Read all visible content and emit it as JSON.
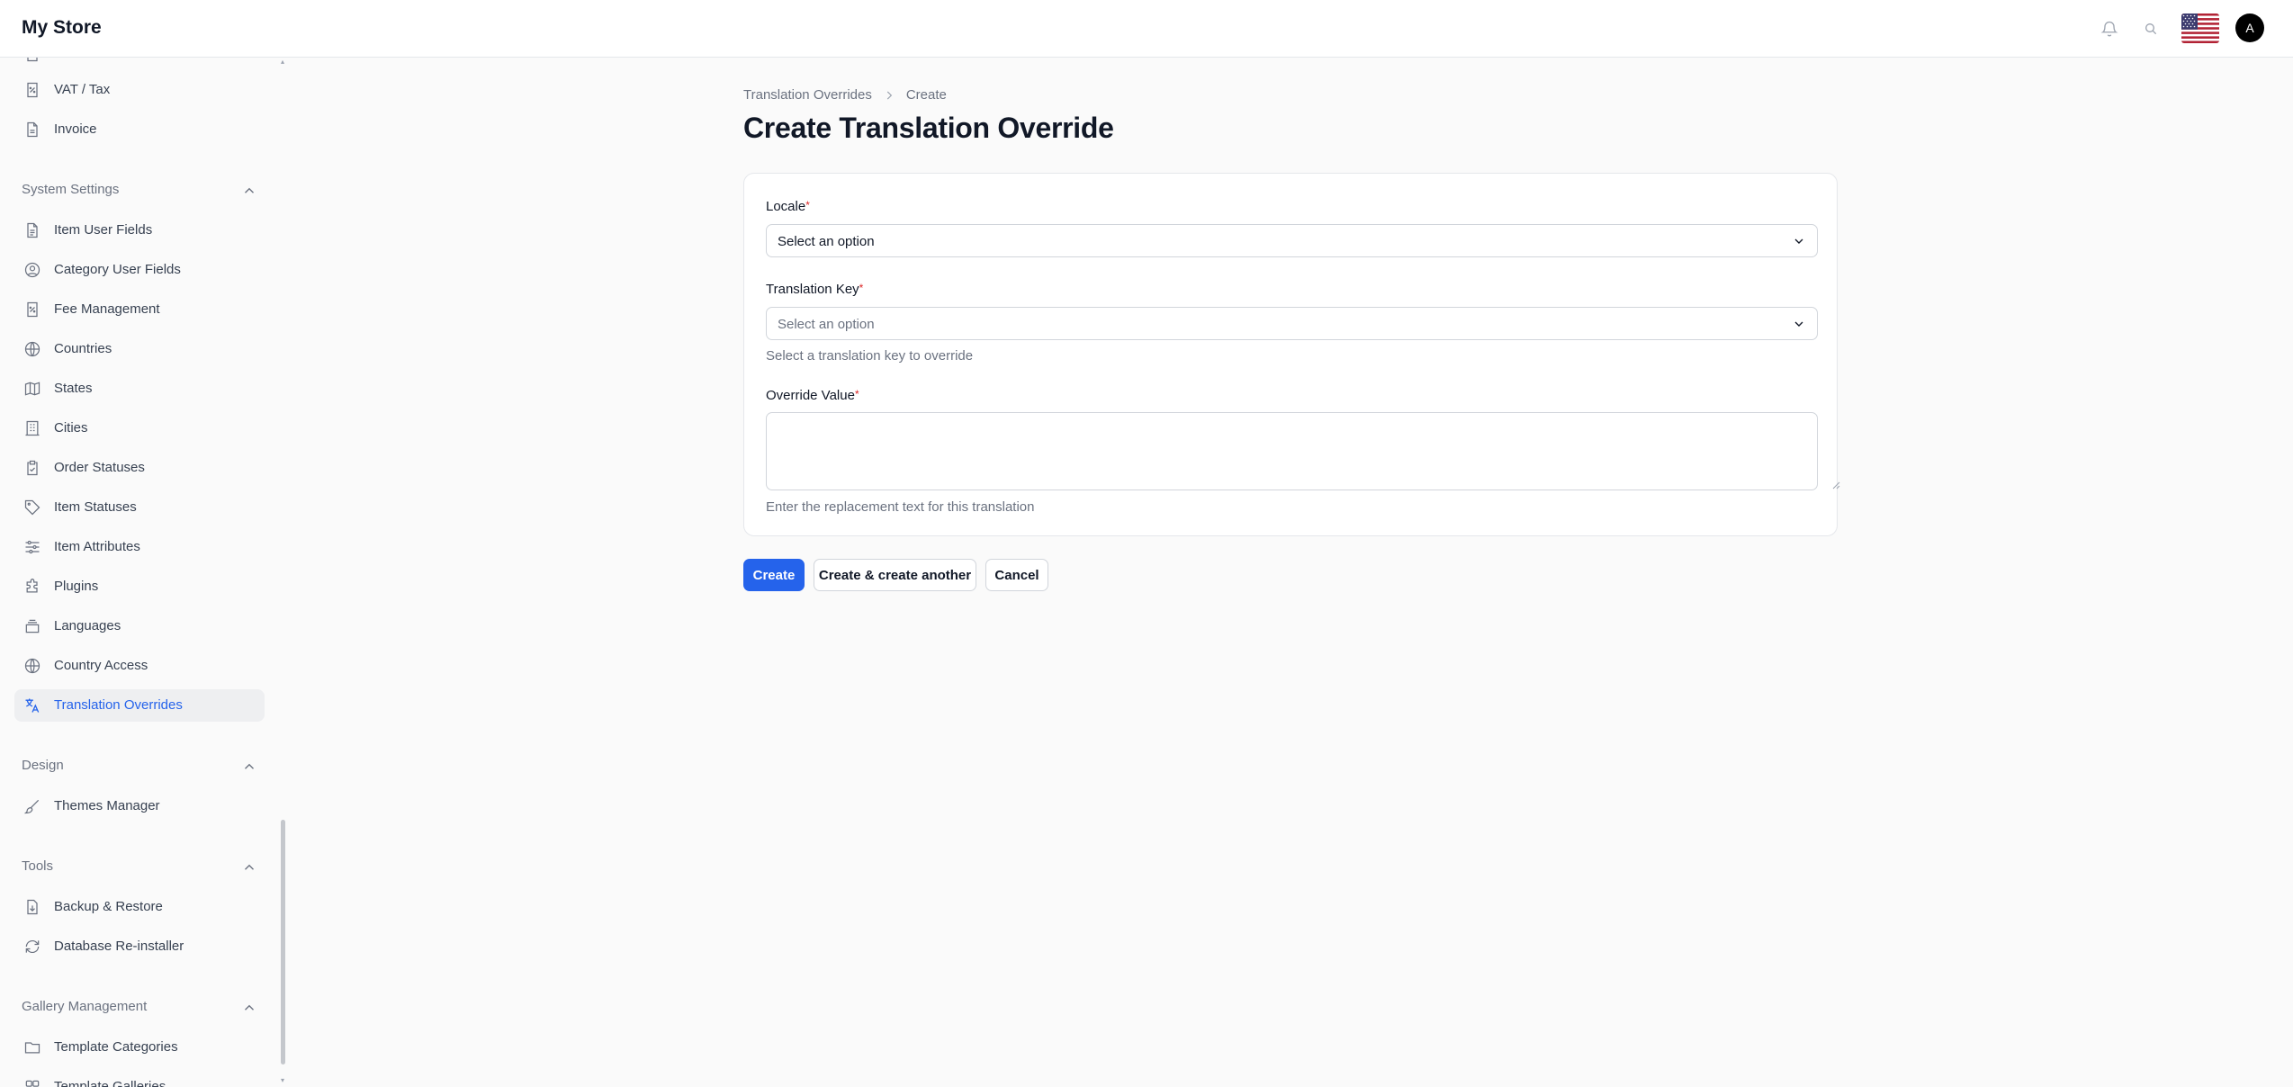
{
  "app": {
    "title": "My Store",
    "avatar_initial": "A"
  },
  "sidebar": {
    "items_top": [
      {
        "label": "VAT / Tax",
        "icon": "receipt-percent-icon"
      },
      {
        "label": "Invoice",
        "icon": "document-icon"
      }
    ],
    "sections": [
      {
        "title": "System Settings",
        "items": [
          {
            "label": "Item User Fields",
            "icon": "document-text-icon"
          },
          {
            "label": "Category User Fields",
            "icon": "user-circle-icon"
          },
          {
            "label": "Fee Management",
            "icon": "receipt-percent-icon"
          },
          {
            "label": "Countries",
            "icon": "globe-icon"
          },
          {
            "label": "States",
            "icon": "map-icon"
          },
          {
            "label": "Cities",
            "icon": "building-icon"
          },
          {
            "label": "Order Statuses",
            "icon": "clipboard-check-icon"
          },
          {
            "label": "Item Statuses",
            "icon": "tag-icon"
          },
          {
            "label": "Item Attributes",
            "icon": "sliders-icon"
          },
          {
            "label": "Plugins",
            "icon": "puzzle-icon"
          },
          {
            "label": "Languages",
            "icon": "stack-icon"
          },
          {
            "label": "Country Access",
            "icon": "globe-icon"
          },
          {
            "label": "Translation Overrides",
            "icon": "language-icon",
            "active": true
          }
        ]
      },
      {
        "title": "Design",
        "items": [
          {
            "label": "Themes Manager",
            "icon": "paint-brush-icon"
          }
        ]
      },
      {
        "title": "Tools",
        "items": [
          {
            "label": "Backup & Restore",
            "icon": "document-download-icon"
          },
          {
            "label": "Database Re-installer",
            "icon": "refresh-icon"
          }
        ]
      },
      {
        "title": "Gallery Management",
        "items": [
          {
            "label": "Template Categories",
            "icon": "folder-icon"
          },
          {
            "label": "Template Galleries",
            "icon": "squares-icon"
          }
        ]
      }
    ]
  },
  "breadcrumb": {
    "parent": "Translation Overrides",
    "current": "Create"
  },
  "page": {
    "title": "Create Translation Override"
  },
  "form": {
    "locale": {
      "label": "Locale",
      "required_mark": "*",
      "value": "Select an option"
    },
    "translation_key": {
      "label": "Translation Key",
      "required_mark": "*",
      "placeholder": "Select an option",
      "hint": "Select a translation key to override"
    },
    "override_value": {
      "label": "Override Value",
      "required_mark": "*",
      "value": "",
      "hint": "Enter the replacement text for this translation"
    }
  },
  "actions": {
    "create": "Create",
    "create_another": "Create & create another",
    "cancel": "Cancel"
  },
  "colors": {
    "primary": "#2563eb",
    "active_bg": "#eeeff1",
    "required": "#dc2626"
  }
}
